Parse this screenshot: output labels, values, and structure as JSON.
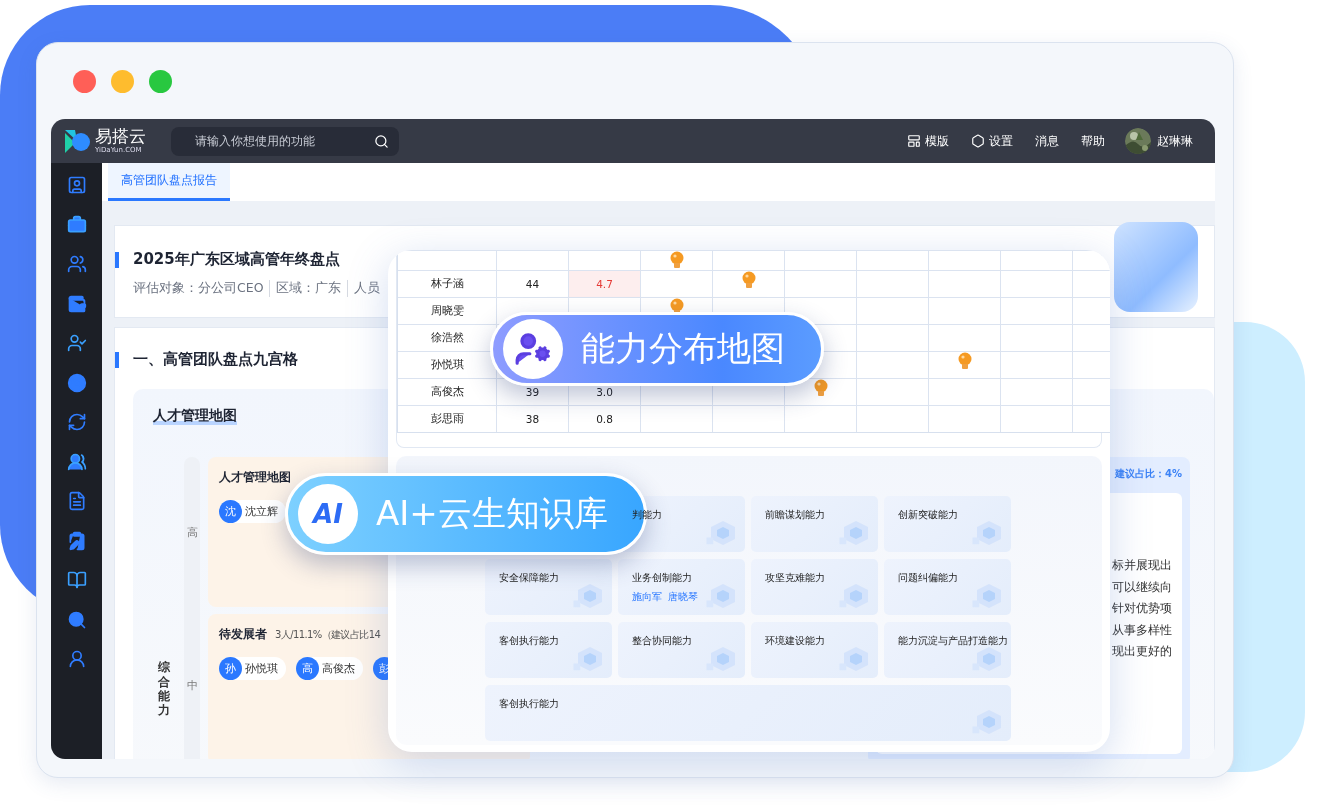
{
  "header": {
    "logo": "易搭云",
    "logo_sub": "YiDaYun.COM",
    "search": {
      "placeholder": "请输入你想使用的功能"
    },
    "actions": [
      {
        "kind": "template",
        "label": "模版"
      },
      {
        "kind": "settings",
        "label": "设置"
      },
      {
        "kind": "plain",
        "label": "消息"
      },
      {
        "kind": "plain",
        "label": "帮助"
      }
    ],
    "user": "赵琳琳"
  },
  "tabs": [
    {
      "label": "高管团队盘点报告",
      "selected": true
    }
  ],
  "report": {
    "title": "2025年广东区域高管年终盘点",
    "meta": [
      "评估对象：分公司CEO",
      "区域：广东",
      "人员"
    ]
  },
  "section": {
    "title": "一、高管团队盘点九宫格",
    "panel_title": "人才管理地图",
    "axis_label": "综合能力",
    "levels": [
      "高",
      "中"
    ],
    "cells": [
      {
        "title": "人才管理地图",
        "chips": [
          {
            "avatar": "沈",
            "name": "沈立辉"
          }
        ]
      },
      {
        "title": "待发展者",
        "note": "3人/11.1%（建议占比14",
        "chips": [
          {
            "avatar": "孙",
            "name": "孙悦琪"
          },
          {
            "avatar": "高",
            "name": "高俊杰"
          },
          {
            "avatar": "彭"
          }
        ]
      }
    ],
    "side_cell": {
      "ratio": "建议占比：4%",
      "lines": [
        "标并展现出",
        "可以继续向",
        "针对优势项",
        "从事多样性",
        "现出更好的"
      ]
    }
  },
  "overlay": {
    "table_rows": [
      {
        "partial": true,
        "bulbs": [
          true,
          false,
          false,
          false,
          false,
          false,
          false
        ]
      },
      {
        "name": "林子涵",
        "score": "44",
        "value": "4.7",
        "highlight": true,
        "bulbs": [
          false,
          true,
          false,
          false,
          false,
          false,
          false
        ]
      },
      {
        "name": "周晓雯",
        "highlight": false,
        "bulbs": [
          true,
          false,
          false,
          false,
          false,
          false,
          false
        ]
      },
      {
        "name": "徐浩然",
        "highlight": false,
        "bulbs": [
          false,
          false,
          false,
          false,
          false,
          false,
          false
        ]
      },
      {
        "name": "孙悦琪",
        "highlight": false,
        "bulbs": [
          false,
          false,
          false,
          false,
          true,
          false,
          false
        ]
      },
      {
        "name": "高俊杰",
        "score": "39",
        "value": "3.0",
        "highlight": false,
        "bulbs": [
          false,
          false,
          true,
          false,
          false,
          false,
          false
        ]
      },
      {
        "name": "彭思雨",
        "score": "38",
        "value": "0.8",
        "highlight": false,
        "bulbs": [
          false,
          false,
          false,
          false,
          false,
          false,
          false
        ]
      }
    ],
    "abilities": [
      {
        "label": "判能力"
      },
      {
        "label": "前瞻谋划能力"
      },
      {
        "label": "创新突破能力"
      },
      {
        "label": "安全保障能力"
      },
      {
        "label": "业务创制能力",
        "people": [
          "施向军",
          "唐晓琴"
        ]
      },
      {
        "label": "攻坚克难能力"
      },
      {
        "label": "问题纠偏能力"
      },
      {
        "label": "客创执行能力"
      },
      {
        "label": "整合协同能力"
      },
      {
        "label": "环境建设能力"
      },
      {
        "label": "能力沉淀与产品打造能力"
      },
      {
        "label": "客创执行能力",
        "wide": true
      }
    ]
  },
  "badges": [
    {
      "kind": "map",
      "label": "能力分布地图"
    },
    {
      "kind": "ai",
      "logo": "AI",
      "label": "AI+云生知识库"
    }
  ]
}
